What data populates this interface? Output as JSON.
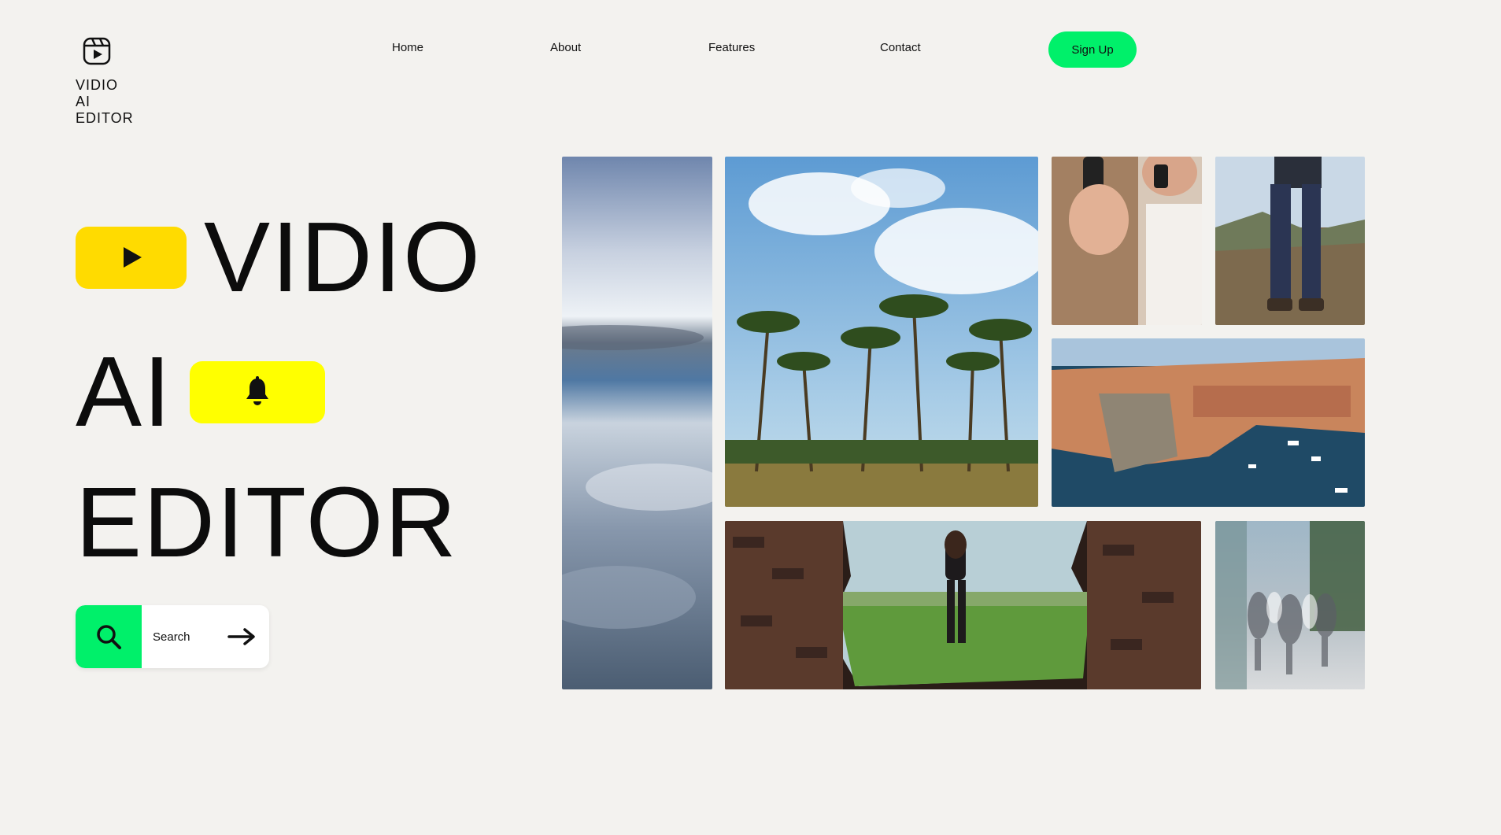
{
  "brand": {
    "lines": [
      "VIDIO",
      "AI",
      "EDITOR"
    ],
    "icon": "play-reel-icon"
  },
  "nav": {
    "items": [
      "Home",
      "About",
      "Features",
      "Contact"
    ],
    "signup_label": "Sign Up"
  },
  "hero": {
    "line1": "VIDIO",
    "line2": "AI",
    "line3": "EDITOR",
    "play_icon": "play-icon",
    "bell_icon": "bell-icon"
  },
  "search": {
    "label": "Search",
    "icon": "search-icon",
    "arrow_icon": "arrow-right-icon"
  },
  "gallery": {
    "photos": [
      "aerial-clouds-photo",
      "palm-trees-photo",
      "phone-selfie-photo",
      "hiker-legs-photo",
      "coastal-town-photo",
      "woman-through-wall-photo",
      "blurred-crowd-photo"
    ]
  },
  "colors": {
    "background": "#f3f2ef",
    "accent_green": "#00f06a",
    "play_yellow": "#ffdb00",
    "bell_yellow": "#ffff00",
    "text": "#111111"
  }
}
